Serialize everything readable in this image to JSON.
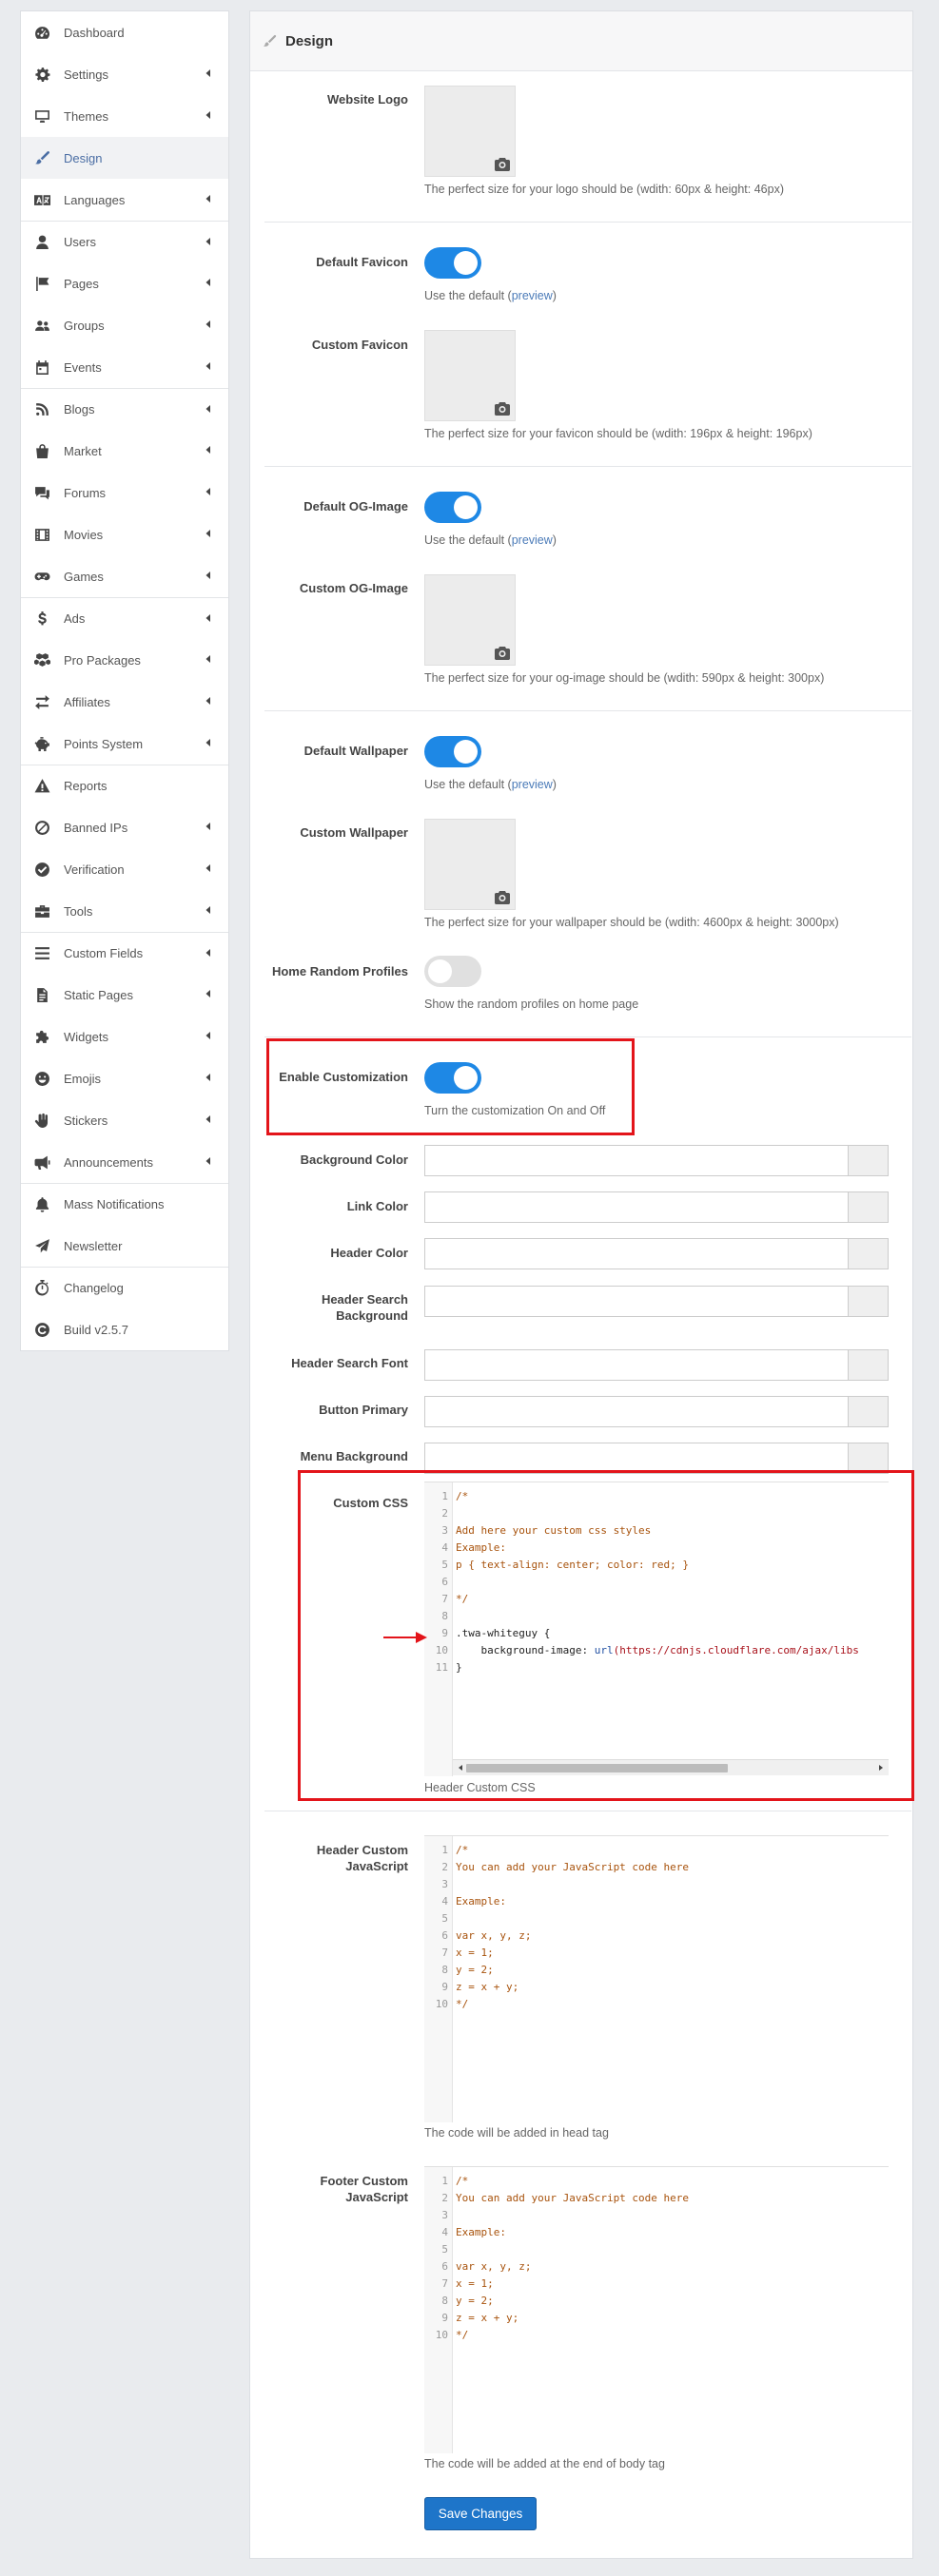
{
  "sidebar": {
    "items": [
      {
        "label": "Dashboard",
        "icon": "dashboard-icon",
        "chevron": false,
        "active": false
      },
      {
        "label": "Settings",
        "icon": "gear-icon",
        "chevron": true,
        "active": false
      },
      {
        "label": "Themes",
        "icon": "monitor-icon",
        "chevron": true,
        "active": false
      },
      {
        "label": "Design",
        "icon": "paint-brush-icon",
        "chevron": false,
        "active": true
      },
      {
        "label": "Languages",
        "icon": "language-icon",
        "chevron": true,
        "active": false
      },
      {
        "label": "Users",
        "icon": "user-icon",
        "chevron": true,
        "active": false
      },
      {
        "label": "Pages",
        "icon": "flag-icon",
        "chevron": true,
        "active": false
      },
      {
        "label": "Groups",
        "icon": "users-icon",
        "chevron": true,
        "active": false
      },
      {
        "label": "Events",
        "icon": "calendar-icon",
        "chevron": true,
        "active": false
      },
      {
        "label": "Blogs",
        "icon": "blog-icon",
        "chevron": true,
        "active": false
      },
      {
        "label": "Market",
        "icon": "shopping-bag-icon",
        "chevron": true,
        "active": false
      },
      {
        "label": "Forums",
        "icon": "forums-icon",
        "chevron": true,
        "active": false
      },
      {
        "label": "Movies",
        "icon": "film-icon",
        "chevron": true,
        "active": false
      },
      {
        "label": "Games",
        "icon": "gamepad-icon",
        "chevron": true,
        "active": false
      },
      {
        "label": "Ads",
        "icon": "dollar-icon",
        "chevron": true,
        "active": false
      },
      {
        "label": "Pro Packages",
        "icon": "cubes-icon",
        "chevron": true,
        "active": false
      },
      {
        "label": "Affiliates",
        "icon": "exchange-icon",
        "chevron": true,
        "active": false
      },
      {
        "label": "Points System",
        "icon": "piggy-bank-icon",
        "chevron": true,
        "active": false
      },
      {
        "label": "Reports",
        "icon": "warning-icon",
        "chevron": false,
        "active": false
      },
      {
        "label": "Banned IPs",
        "icon": "ban-icon",
        "chevron": true,
        "active": false
      },
      {
        "label": "Verification",
        "icon": "check-circle-icon",
        "chevron": true,
        "active": false
      },
      {
        "label": "Tools",
        "icon": "toolbox-icon",
        "chevron": true,
        "active": false
      },
      {
        "label": "Custom Fields",
        "icon": "list-icon",
        "chevron": true,
        "active": false
      },
      {
        "label": "Static Pages",
        "icon": "file-icon",
        "chevron": true,
        "active": false
      },
      {
        "label": "Widgets",
        "icon": "puzzle-icon",
        "chevron": true,
        "active": false
      },
      {
        "label": "Emojis",
        "icon": "smile-icon",
        "chevron": true,
        "active": false
      },
      {
        "label": "Stickers",
        "icon": "hand-icon",
        "chevron": true,
        "active": false
      },
      {
        "label": "Announcements",
        "icon": "bullhorn-icon",
        "chevron": true,
        "active": false
      },
      {
        "label": "Mass Notifications",
        "icon": "bell-icon",
        "chevron": false,
        "active": false
      },
      {
        "label": "Newsletter",
        "icon": "paper-plane-icon",
        "chevron": false,
        "active": false
      },
      {
        "label": "Changelog",
        "icon": "stopwatch-icon",
        "chevron": false,
        "active": false
      },
      {
        "label": "Build v2.5.7",
        "icon": "copyright-icon",
        "chevron": false,
        "active": false
      }
    ]
  },
  "page": {
    "title": "Design"
  },
  "form": {
    "website_logo": {
      "label": "Website Logo",
      "help": "The perfect size for your logo should be (wdith: 60px & height: 46px)"
    },
    "default_favicon": {
      "label": "Default Favicon",
      "help_prefix": "Use the default (",
      "link": "preview",
      "help_suffix": ")",
      "on": true
    },
    "custom_favicon": {
      "label": "Custom Favicon",
      "help": "The perfect size for your favicon should be (wdith: 196px & height: 196px)"
    },
    "default_og": {
      "label": "Default OG-Image",
      "help_prefix": "Use the default (",
      "link": "preview",
      "help_suffix": ")",
      "on": true
    },
    "custom_og": {
      "label": "Custom OG-Image",
      "help": "The perfect size for your og-image should be (wdith: 590px & height: 300px)"
    },
    "default_wallpaper": {
      "label": "Default Wallpaper",
      "help_prefix": "Use the default (",
      "link": "preview",
      "help_suffix": ")",
      "on": true
    },
    "custom_wallpaper": {
      "label": "Custom Wallpaper",
      "help": "The perfect size for your wallpaper should be (wdith: 4600px & height: 3000px)"
    },
    "home_random": {
      "label": "Home Random Profiles",
      "help": "Show the random profiles on home page",
      "on": false
    },
    "enable_custom": {
      "label": "Enable Customization",
      "help": "Turn the customization On and Off",
      "on": true
    },
    "colors": {
      "background": {
        "label": "Background Color",
        "value": ""
      },
      "link": {
        "label": "Link Color",
        "value": ""
      },
      "header": {
        "label": "Header Color",
        "value": ""
      },
      "header_search_bg": {
        "label": "Header Search Background",
        "value": ""
      },
      "header_search_font": {
        "label": "Header Search Font",
        "value": ""
      },
      "button_primary": {
        "label": "Button Primary",
        "value": ""
      },
      "menu_bg": {
        "label": "Menu Background",
        "value": ""
      }
    },
    "custom_css": {
      "label": "Custom CSS",
      "help": "Header Custom CSS",
      "lines": [
        {
          "n": "1",
          "text": "/*"
        },
        {
          "n": "2",
          "text": ""
        },
        {
          "n": "3",
          "text": "Add here your custom css styles"
        },
        {
          "n": "4",
          "text": "Example:"
        },
        {
          "n": "5",
          "text": "p { text-align: center; color: red; }"
        },
        {
          "n": "6",
          "text": ""
        },
        {
          "n": "7",
          "text": "*/"
        },
        {
          "n": "8",
          "text": ""
        },
        {
          "n": "9",
          "text": ".twa-whiteguy {"
        },
        {
          "n": "10",
          "text": "    background-image: url(https://cdnjs.cloudflare.com/ajax/libs"
        },
        {
          "n": "11",
          "text": "}"
        }
      ],
      "line10_prop": "    background-image: ",
      "line10_fn": "url",
      "line10_url": "(https://cdnjs.cloudflare.com/ajax/libs"
    },
    "header_js": {
      "label": "Header Custom JavaScript",
      "help": "The code will be added in head tag",
      "lines": [
        {
          "n": "1",
          "text": "/*"
        },
        {
          "n": "2",
          "text": "You can add your JavaScript code here"
        },
        {
          "n": "3",
          "text": ""
        },
        {
          "n": "4",
          "text": "Example:"
        },
        {
          "n": "5",
          "text": ""
        },
        {
          "n": "6",
          "text": "var x, y, z;"
        },
        {
          "n": "7",
          "text": "x = 1;"
        },
        {
          "n": "8",
          "text": "y = 2;"
        },
        {
          "n": "9",
          "text": "z = x + y;"
        },
        {
          "n": "10",
          "text": "*/"
        }
      ]
    },
    "footer_js": {
      "label": "Footer Custom JavaScript",
      "help": "The code will be added at the end of body tag",
      "lines": [
        {
          "n": "1",
          "text": "/*"
        },
        {
          "n": "2",
          "text": "You can add your JavaScript code here"
        },
        {
          "n": "3",
          "text": ""
        },
        {
          "n": "4",
          "text": "Example:"
        },
        {
          "n": "5",
          "text": ""
        },
        {
          "n": "6",
          "text": "var x, y, z;"
        },
        {
          "n": "7",
          "text": "x = 1;"
        },
        {
          "n": "8",
          "text": "y = 2;"
        },
        {
          "n": "9",
          "text": "z = x + y;"
        },
        {
          "n": "10",
          "text": "*/"
        }
      ]
    },
    "save_label": "Save Changes"
  },
  "colors": {
    "accent": "#1e88e5",
    "button": "#1e75c9",
    "highlight": "#e3141a",
    "active_nav": "#4b6ea4"
  }
}
